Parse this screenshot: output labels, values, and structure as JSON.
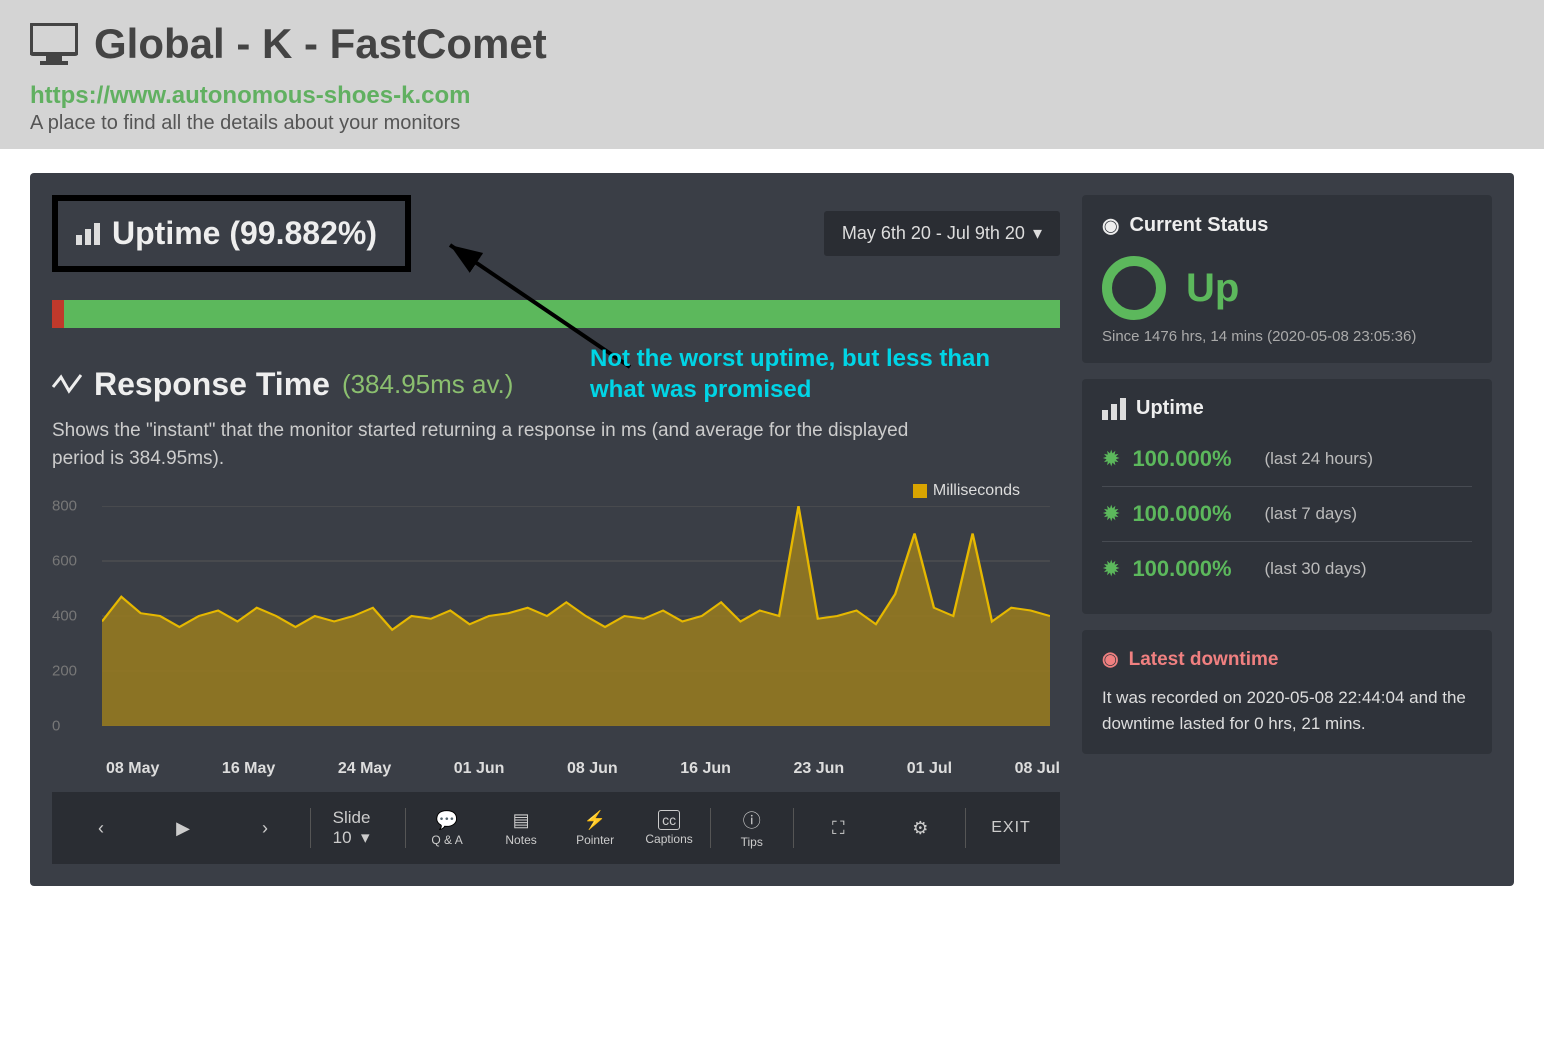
{
  "header": {
    "title": "Global - K - FastComet",
    "url": "https://www.autonomous-shoes-k.com",
    "subtitle": "A place to find all the details about your monitors"
  },
  "uptime": {
    "label": "Uptime (99.882%)",
    "date_range": "May 6th 20 - Jul 9th 20"
  },
  "annotation": {
    "line1": "Not the worst uptime, but less than",
    "line2": "what was promised"
  },
  "response": {
    "title": "Response Time",
    "avg": "(384.95ms av.)",
    "desc": "Shows the \"instant\" that the monitor started returning a response in ms (and average for the displayed period is 384.95ms).",
    "legend": "Milliseconds"
  },
  "chart_data": {
    "type": "area",
    "title": "Response Time",
    "xlabel": "",
    "ylabel": "",
    "ylim": [
      0,
      800
    ],
    "yticks": [
      0,
      200,
      400,
      600,
      800
    ],
    "categories": [
      "08 May",
      "16 May",
      "24 May",
      "01 Jun",
      "08 Jun",
      "16 Jun",
      "23 Jun",
      "01 Jul",
      "08 Jul"
    ],
    "series": [
      {
        "name": "Milliseconds",
        "values": [
          380,
          470,
          410,
          400,
          360,
          400,
          420,
          380,
          430,
          400,
          360,
          400,
          380,
          400,
          430,
          350,
          400,
          390,
          420,
          370,
          400,
          410,
          430,
          400,
          450,
          400,
          360,
          400,
          390,
          420,
          380,
          400,
          450,
          380,
          420,
          400,
          800,
          390,
          400,
          420,
          370,
          480,
          700,
          430,
          400,
          700,
          380,
          430,
          420,
          400
        ]
      }
    ]
  },
  "status": {
    "title": "Current Status",
    "value": "Up",
    "since": "Since 1476 hrs, 14 mins (2020-05-08 23:05:36)"
  },
  "uptime_list": {
    "title": "Uptime",
    "rows": [
      {
        "pct": "100.000%",
        "label": "(last 24 hours)"
      },
      {
        "pct": "100.000%",
        "label": "(last 7 days)"
      },
      {
        "pct": "100.000%",
        "label": "(last 30 days)"
      }
    ]
  },
  "downtime": {
    "title": "Latest downtime",
    "text": "It was recorded on 2020-05-08 22:44:04 and the downtime lasted for 0 hrs, 21 mins."
  },
  "toolbar": {
    "slide": "Slide 10",
    "qa": "Q & A",
    "notes": "Notes",
    "pointer": "Pointer",
    "captions": "Captions",
    "tips": "Tips",
    "exit": "EXIT"
  }
}
